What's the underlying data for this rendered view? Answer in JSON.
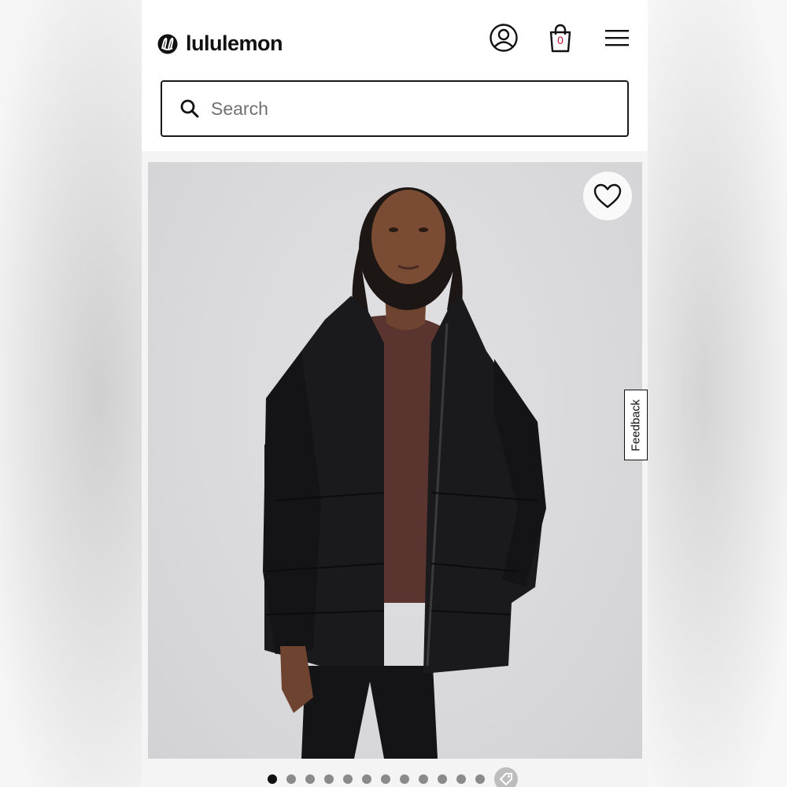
{
  "brand": {
    "name": "lululemon"
  },
  "header": {
    "icons": [
      "account-icon",
      "shopping-bag-icon",
      "menu-icon"
    ],
    "bag_count": "0"
  },
  "search": {
    "placeholder": "Search",
    "value": ""
  },
  "product": {
    "image": "model-in-black-puffer-jacket",
    "favorite_icon": "heart-icon"
  },
  "feedback": {
    "label": "Feedback"
  },
  "carousel": {
    "total_dots": 12,
    "active_index": 0,
    "extra_icon": "tag-icon"
  },
  "colors": {
    "brand_red": "#c8102e",
    "text": "#111111",
    "image_bg": "#d9d9db"
  }
}
